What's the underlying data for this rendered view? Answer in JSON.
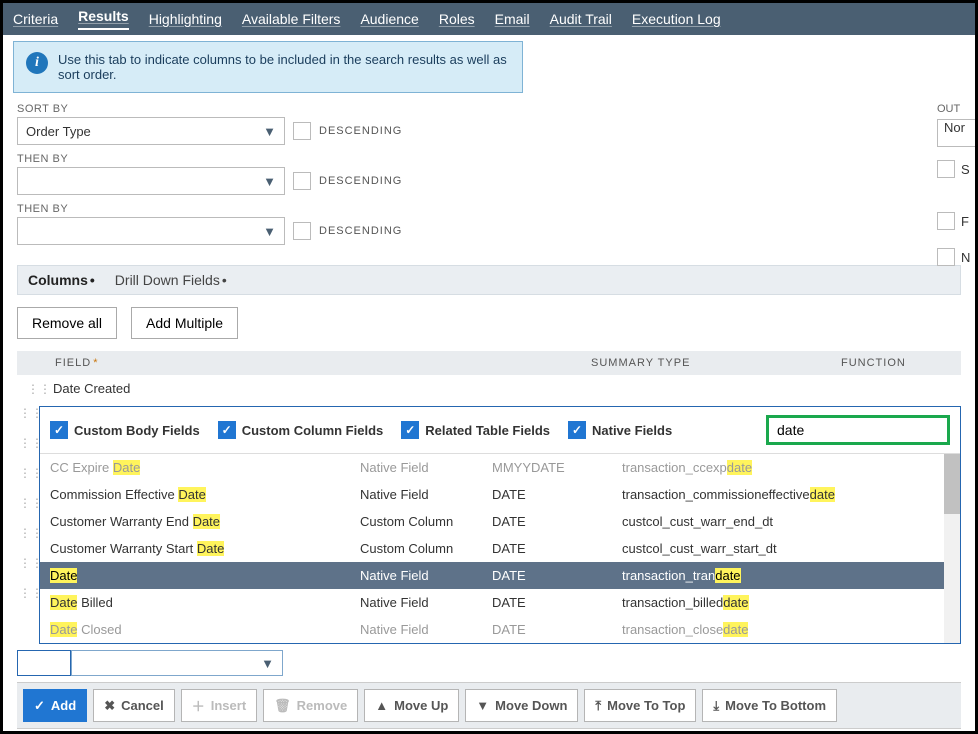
{
  "nav": {
    "items": [
      "Criteria",
      "Results",
      "Highlighting",
      "Available Filters",
      "Audience",
      "Roles",
      "Email",
      "Audit Trail",
      "Execution Log"
    ],
    "active_index": 1
  },
  "info_banner": "Use this tab to indicate columns to be included in the search results as well as sort order.",
  "sort": {
    "label_sort_by": "SORT BY",
    "label_then_by": "THEN BY",
    "sort_by_value": "Order Type",
    "then_by_1_value": "",
    "then_by_2_value": "",
    "descending_label": "DESCENDING"
  },
  "right_peek": {
    "output_label": "OUT",
    "output_value": "Nor",
    "s_label": "S",
    "f_label": "F",
    "n_label": "N"
  },
  "subtabs": {
    "columns": "Columns",
    "drill": "Drill Down Fields"
  },
  "buttons": {
    "remove_all": "Remove all",
    "add_multiple": "Add Multiple"
  },
  "thead": {
    "field": "FIELD",
    "summary": "SUMMARY TYPE",
    "function": "FUNCTION"
  },
  "existing_row": "Date Created",
  "popup": {
    "filters": {
      "custom_body": "Custom Body Fields",
      "custom_column": "Custom Column Fields",
      "related_table": "Related Table Fields",
      "native": "Native Fields"
    },
    "search_value": "date",
    "rows": [
      {
        "name_pre": "CC Expire ",
        "name_hl": "Date",
        "name_post": "",
        "type": "Native Field",
        "dtype": "MMYYDATE",
        "id_pre": "transaction_ccexp",
        "id_hl": "date",
        "id_post": "",
        "cut": true
      },
      {
        "name_pre": "Commission Effective ",
        "name_hl": "Date",
        "name_post": "",
        "type": "Native Field",
        "dtype": "DATE",
        "id_pre": "transaction_commissioneffective",
        "id_hl": "date",
        "id_post": ""
      },
      {
        "name_pre": "Customer Warranty End ",
        "name_hl": "Date",
        "name_post": "",
        "type": "Custom Column",
        "dtype": "DATE",
        "id_pre": "custcol_cust_warr_end_dt",
        "id_hl": "",
        "id_post": ""
      },
      {
        "name_pre": "Customer Warranty Start ",
        "name_hl": "Date",
        "name_post": "",
        "type": "Custom Column",
        "dtype": "DATE",
        "id_pre": "custcol_cust_warr_start_dt",
        "id_hl": "",
        "id_post": ""
      },
      {
        "name_pre": "",
        "name_hl": "Date",
        "name_post": "",
        "type": "Native Field",
        "dtype": "DATE",
        "id_pre": "transaction_tran",
        "id_hl": "date",
        "id_post": "",
        "selected": true
      },
      {
        "name_pre": "",
        "name_hl": "Date",
        "name_post": " Billed",
        "type": "Native Field",
        "dtype": "DATE",
        "id_pre": "transaction_billed",
        "id_hl": "date",
        "id_post": ""
      },
      {
        "name_pre": "",
        "name_hl": "Date",
        "name_post": " Closed",
        "type": "Native Field",
        "dtype": "DATE",
        "id_pre": "transaction_close",
        "id_hl": "date",
        "id_post": "",
        "cut": true
      }
    ]
  },
  "toolbar": {
    "add": "Add",
    "cancel": "Cancel",
    "insert": "Insert",
    "remove": "Remove",
    "move_up": "Move Up",
    "move_down": "Move Down",
    "move_top": "Move To Top",
    "move_bottom": "Move To Bottom"
  }
}
